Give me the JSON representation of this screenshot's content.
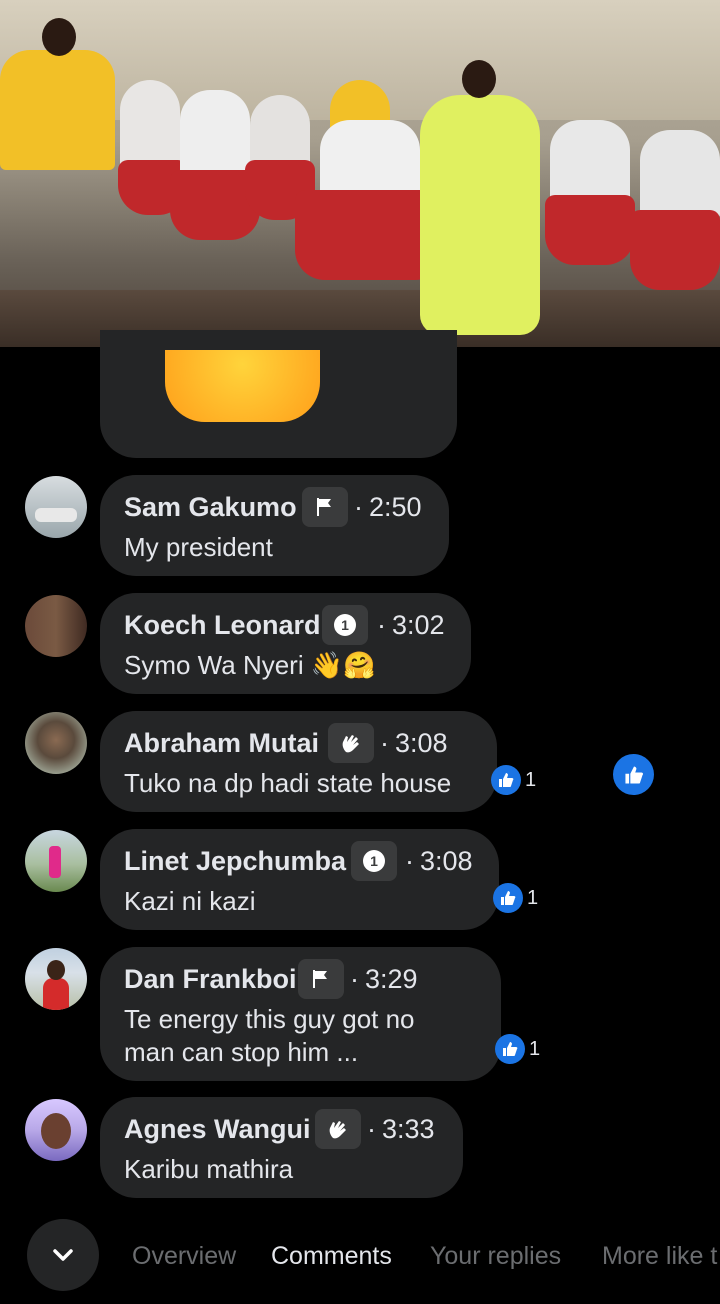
{
  "video": {
    "description": ""
  },
  "comments": [
    {
      "name": "Sam Gakumo",
      "badge": "flag-icon",
      "time": "2:50",
      "text": "My president",
      "likes": ""
    },
    {
      "name": "Koech Leonard",
      "badge": "number-1-icon",
      "time": "3:02",
      "text": "Symo Wa Nyeri 👋🤗",
      "likes": ""
    },
    {
      "name": "Abraham Mutai",
      "badge": "clap-icon",
      "time": "3:08",
      "text": "Tuko na dp hadi state house",
      "likes": "1"
    },
    {
      "name": "Linet Jepchumba",
      "badge": "number-1-icon",
      "time": "3:08",
      "text": "Kazi ni kazi",
      "likes": "1"
    },
    {
      "name": "Dan Frankboi",
      "badge": "flag-icon",
      "time": "3:29",
      "text_line1": "Te energy this guy got no",
      "text_line2": "man can stop him ...",
      "likes": "1"
    },
    {
      "name": "Agnes Wangui",
      "badge": "clap-icon",
      "time": "3:33",
      "text": "Karibu mathira",
      "likes": ""
    }
  ],
  "tabs": [
    "Overview",
    "Comments",
    "Your replies",
    "More like t"
  ],
  "active_tab": "Comments",
  "colors": {
    "background": "#000000",
    "bubble": "#242526",
    "like_blue": "#1b74e4",
    "text": "#e4e6eb",
    "muted": "#6b6d70"
  }
}
